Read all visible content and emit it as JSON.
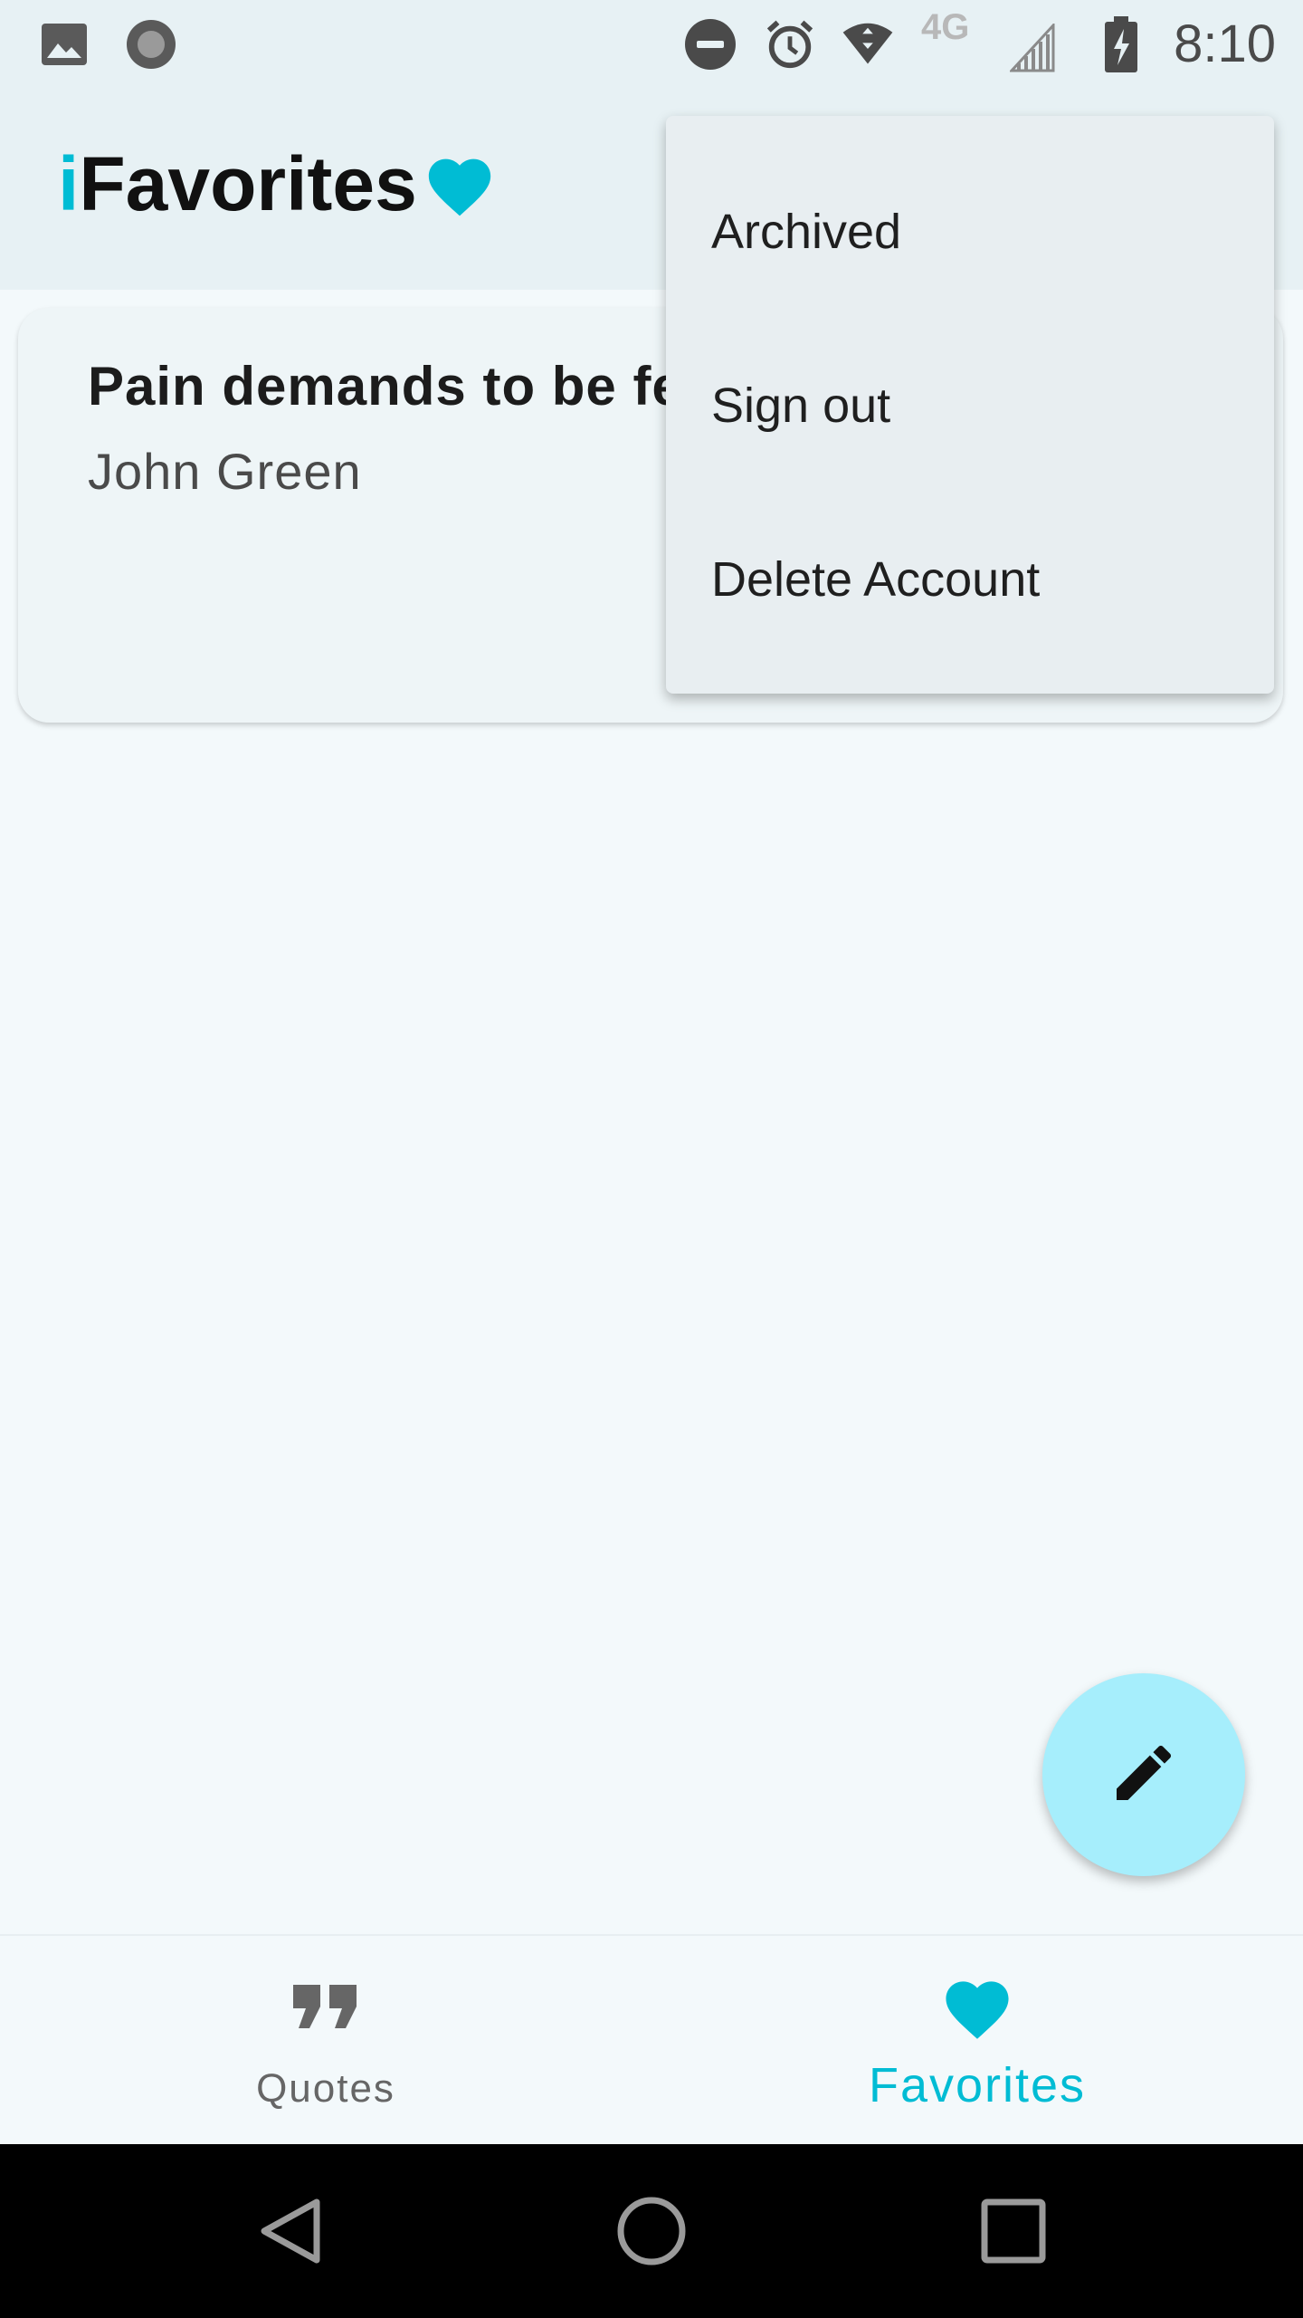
{
  "status_bar": {
    "time": "8:10",
    "network_label": "4G",
    "icons": [
      "image-icon",
      "record-icon",
      "dnd-icon",
      "alarm-icon",
      "wifi-icon",
      "signal-icon",
      "battery-charging-icon"
    ]
  },
  "app_bar": {
    "title_accent": "i",
    "title_rest": "Favorites",
    "logo_icon": "heart-icon"
  },
  "card": {
    "quote": "Pain demands to be felt.",
    "author": "John Green"
  },
  "menu": {
    "items": [
      {
        "label": "Archived"
      },
      {
        "label": "Sign out"
      },
      {
        "label": "Delete Account"
      }
    ]
  },
  "fab": {
    "icon": "pencil-icon"
  },
  "bottom_nav": {
    "items": [
      {
        "label": "Quotes",
        "icon": "quote-icon",
        "active": false
      },
      {
        "label": "Favorites",
        "icon": "heart-icon",
        "active": true
      }
    ]
  },
  "colors": {
    "accent": "#00bcd4",
    "fab": "#a6eefc",
    "inactive": "#666666"
  }
}
